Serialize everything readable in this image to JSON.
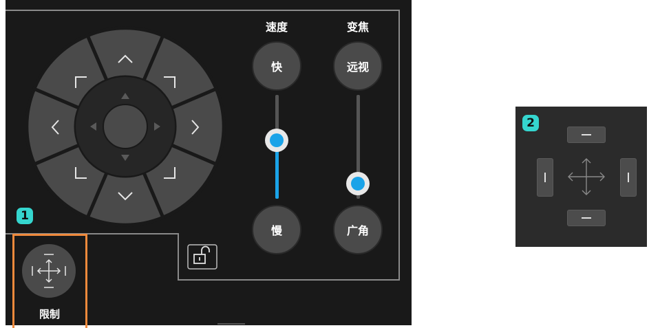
{
  "speed": {
    "header": "速度",
    "fast_label": "快",
    "slow_label": "慢",
    "slider_level": 0.6
  },
  "zoom": {
    "header": "变焦",
    "tele_label": "远视",
    "wide_label": "广角",
    "slider_level": 0.1
  },
  "restrict": {
    "label": "限制",
    "badge": "1"
  },
  "panel2": {
    "badge": "2"
  },
  "icons": {
    "ptz": [
      "up-arrow-icon",
      "down-arrow-icon",
      "left-arrow-icon",
      "right-arrow-icon",
      "up-left-corner-icon",
      "up-right-corner-icon",
      "down-left-corner-icon",
      "down-right-corner-icon"
    ],
    "lock": "unlock-icon",
    "restrict": "move-restrict-icon"
  },
  "colors": {
    "panel_bg": "#191919",
    "button": "#4a4a4a",
    "accent": "#1aa3e8",
    "badge": "#35d6cf",
    "highlight": "#f08a3c"
  }
}
